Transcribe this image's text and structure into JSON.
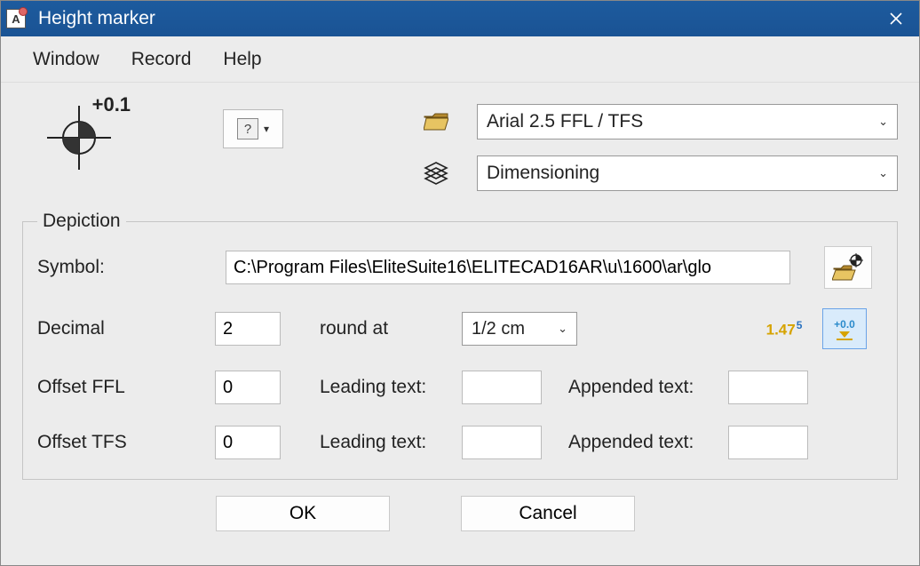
{
  "title": "Height marker",
  "menu": {
    "window": "Window",
    "record": "Record",
    "help": "Help"
  },
  "topIconLabel": "+0.1",
  "fontSelect": "Arial 2.5 FFL / TFS",
  "layerSelect": "Dimensioning",
  "depiction": {
    "legend": "Depiction",
    "symbolLabel": "Symbol:",
    "symbolPath": "C:\\Program Files\\EliteSuite16\\ELITECAD16AR\\u\\1600\\ar\\glo",
    "decimalLabel": "Decimal",
    "decimalValue": "2",
    "roundAtLabel": "round at",
    "roundAtValue": "1/2 cm",
    "offsetFFLLabel": "Offset FFL",
    "offsetFFLValue": "0",
    "offsetTFSLabel": "Offset TFS",
    "offsetTFSValue": "0",
    "leadingLabel": "Leading text:",
    "appendedLabel": "Appended text:",
    "leadingFFL": "",
    "appendedFFL": "",
    "leadingTFS": "",
    "appendedTFS": "",
    "badge147": "1.47",
    "badge147sup": "5",
    "badge00": "+0.0"
  },
  "buttons": {
    "ok": "OK",
    "cancel": "Cancel"
  }
}
